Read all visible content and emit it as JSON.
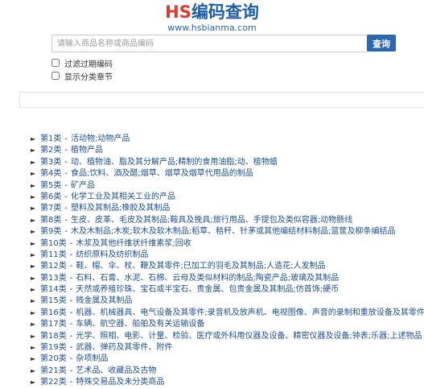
{
  "header": {
    "logo_hs": "HS",
    "logo_title": "编码查询",
    "url": "www.hsbianma.com"
  },
  "search": {
    "placeholder": "请输入商品名称或商品编码",
    "value": "",
    "button_label": "查询"
  },
  "options": [
    {
      "label": "过滤过期编码",
      "checked": false
    },
    {
      "label": "显示分类章节",
      "checked": false
    }
  ],
  "categories": [
    {
      "code": "第1类",
      "name": "活动物;动物产品"
    },
    {
      "code": "第2类",
      "name": "植物产品"
    },
    {
      "code": "第3类",
      "name": "动、植物油、脂及其分解产品;精制的食用油脂;动、植物蜡"
    },
    {
      "code": "第4类",
      "name": "食品;饮料、酒及醋;烟草、烟草及烟草代用品的制品"
    },
    {
      "code": "第5类",
      "name": "矿产品"
    },
    {
      "code": "第6类",
      "name": "化学工业及其相关工业的产品"
    },
    {
      "code": "第7类",
      "name": "塑料及其制品;橡胶及其制品"
    },
    {
      "code": "第8类",
      "name": "生皮、皮革、毛皮及其制品;鞍具及挽具;旅行用品、手提包及类似容器;动物肠线"
    },
    {
      "code": "第9类",
      "name": "木及木制品;木炭;软木及软木制品;稻草、秸秆、针茅或其他编结材料制品;篮筐及柳条编结品"
    },
    {
      "code": "第10类",
      "name": "木浆及其他纤维状纤维素浆;回收"
    },
    {
      "code": "第11类",
      "name": "纺织原料及纺织制品"
    },
    {
      "code": "第12类",
      "name": "鞋、帽、伞、杖、鞭及其零件;已加工的羽毛及其制品;人造花;人发制品"
    },
    {
      "code": "第13类",
      "name": "石料、石膏、水泥、石棉、云母及类似材料的制品;陶瓷产品;玻璃及其制品"
    },
    {
      "code": "第14类",
      "name": "天然或养殖珍珠、宝石或半宝石、贵金属、包贵金属及其制品;仿首饰;硬币"
    },
    {
      "code": "第15类",
      "name": "贱金属及其制品"
    },
    {
      "code": "第16类",
      "name": "机器、机械器具、电气设备及其零件;录音机及放声机、电视图像、声音的录制和重放设备及其零件"
    },
    {
      "code": "第17类",
      "name": "车辆、航空器、船舶及有关运输设备"
    },
    {
      "code": "第18类",
      "name": "光学、照相、电影、计量、检验、医疗或外科用仪器及设备、精密仪器及设备;钟表;乐器;上述物品"
    },
    {
      "code": "第19类",
      "name": "武器、弹药及其零件、附件"
    },
    {
      "code": "第20类",
      "name": "杂项制品"
    },
    {
      "code": "第21类",
      "name": "艺术品、收藏品及古物"
    },
    {
      "code": "第22类",
      "name": "特殊交易品及未分类商品"
    }
  ],
  "colors": {
    "logo_hs": "#e03a2e",
    "logo_title": "#1f5fa6",
    "button_bg": "#2c67b2",
    "link": "#1f4f8e"
  },
  "icons": {
    "list_marker": "arrow-right-icon"
  }
}
